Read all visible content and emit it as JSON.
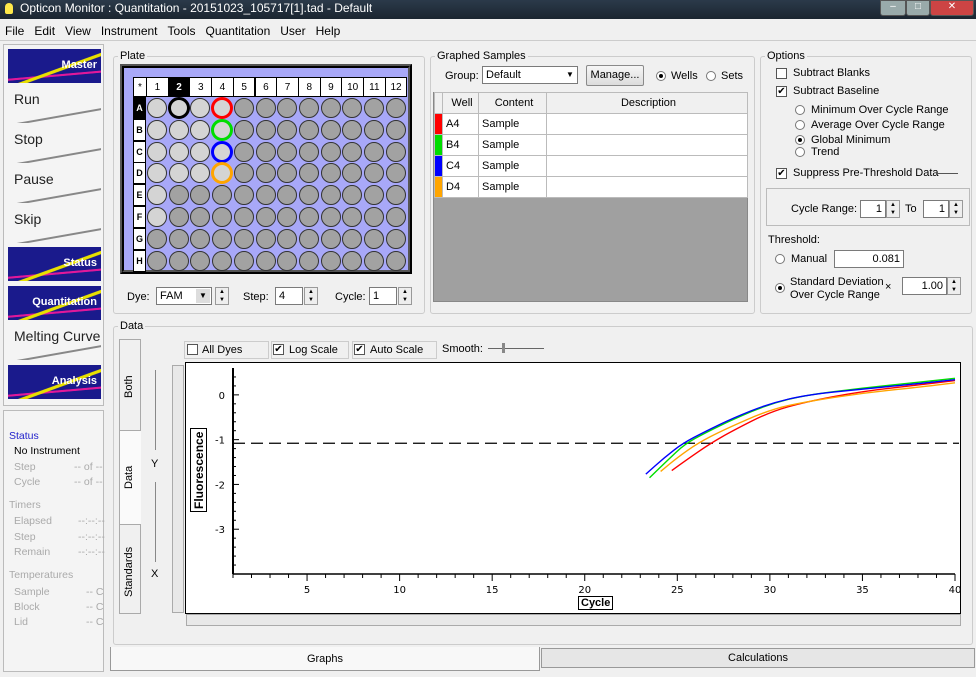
{
  "window": {
    "title": "Opticon Monitor : Quantitation - 20151023_105717[1].tad - Default"
  },
  "menu": [
    "File",
    "Edit",
    "View",
    "Instrument",
    "Tools",
    "Quantitation",
    "User",
    "Help"
  ],
  "toolbar": [
    {
      "label": "Master",
      "style": "dark",
      "icon": "master-icon"
    },
    {
      "label": "Run",
      "style": "light",
      "icon": "run-icon"
    },
    {
      "label": "Stop",
      "style": "light",
      "icon": "stop-icon"
    },
    {
      "label": "Pause",
      "style": "light",
      "icon": "pause-icon"
    },
    {
      "label": "Skip",
      "style": "light",
      "icon": "skip-icon"
    },
    {
      "label": "Status",
      "style": "dark",
      "icon": "status-icon"
    },
    {
      "label": "Quantitation",
      "style": "dark",
      "icon": "quantitation-icon"
    },
    {
      "label": "Melting Curve",
      "style": "light",
      "icon": "melting-curve-icon"
    },
    {
      "label": "Analysis",
      "style": "dark",
      "icon": "analysis-icon"
    }
  ],
  "status": {
    "header": "Status",
    "instrument": "No Instrument",
    "step_label": "Step",
    "step_value": "-- of --",
    "cycle_label": "Cycle",
    "cycle_value": "-- of --",
    "timers": "Timers",
    "elapsed": "Elapsed",
    "elapsed_value": "--:--:--",
    "tstep": "Step",
    "tstep_value": "--:--:--",
    "remain": "Remain",
    "remain_value": "--:--:--",
    "temps": "Temperatures",
    "sample": "Sample",
    "sample_value": "-- C",
    "block": "Block",
    "block_value": "-- C",
    "lid": "Lid",
    "lid_value": "-- C"
  },
  "plate": {
    "title": "Plate",
    "corner": "*",
    "columns": [
      "1",
      "2",
      "3",
      "4",
      "5",
      "6",
      "7",
      "8",
      "9",
      "10",
      "11",
      "12"
    ],
    "rows": [
      "A",
      "B",
      "C",
      "D",
      "E",
      "F",
      "G",
      "H"
    ],
    "selected_column": "2",
    "selected_row": "A",
    "highlighted_wells": [
      {
        "well": "A2",
        "color": "#000000"
      },
      {
        "well": "A4",
        "color": "#ff0000"
      },
      {
        "well": "B4",
        "color": "#00dd00"
      },
      {
        "well": "C4",
        "color": "#0000ff"
      },
      {
        "well": "D4",
        "color": "#ffa500"
      }
    ],
    "dye_label": "Dye:",
    "dye": "FAM",
    "step_label": "Step:",
    "step": "4",
    "cycle_label": "Cycle:",
    "cycle": "1"
  },
  "graphed": {
    "title": "Graphed Samples",
    "group_label": "Group:",
    "group": "Default",
    "manage": "Manage...",
    "wells_label": "Wells",
    "sets_label": "Sets",
    "mode": "Wells",
    "columns": [
      "Well",
      "Content",
      "Description"
    ],
    "rows": [
      {
        "well": "A4",
        "content": "Sample",
        "description": "",
        "color": "#ff0000"
      },
      {
        "well": "B4",
        "content": "Sample",
        "description": "",
        "color": "#00dd00"
      },
      {
        "well": "C4",
        "content": "Sample",
        "description": "",
        "color": "#0000ff"
      },
      {
        "well": "D4",
        "content": "Sample",
        "description": "",
        "color": "#ffa500"
      }
    ]
  },
  "options": {
    "title": "Options",
    "subtract_blanks": "Subtract Blanks",
    "subtract_blanks_checked": false,
    "subtract_baseline": "Subtract Baseline",
    "subtract_baseline_checked": true,
    "baseline_modes": [
      "Minimum Over Cycle Range",
      "Average Over Cycle Range",
      "Global Minimum",
      "Trend"
    ],
    "baseline_selected": "Global Minimum",
    "suppress": "Suppress Pre-Threshold Data",
    "suppress_checked": true,
    "cycle_range_label": "Cycle Range:",
    "cycle_from": "1",
    "to_label": "To",
    "cycle_to": "1",
    "threshold_label": "Threshold:",
    "manual_label": "Manual",
    "manual_value": "0.081",
    "stddev_label1": "Standard Deviation",
    "stddev_label2": "Over Cycle Range",
    "times": "×",
    "stddev_value": "1.00",
    "threshold_mode": "Standard Deviation"
  },
  "data": {
    "title": "Data",
    "side_tabs": [
      "Both",
      "Data",
      "Standards"
    ],
    "active_side_tab": "Data",
    "all_dyes": "All Dyes",
    "all_dyes_checked": false,
    "log_scale": "Log Scale",
    "log_scale_checked": true,
    "auto_scale": "Auto Scale",
    "auto_scale_checked": true,
    "smooth_label": "Smooth:",
    "y_slider": "Y",
    "x_slider": "X"
  },
  "chart_data": {
    "type": "line",
    "xlabel": "Cycle",
    "ylabel": "Fluorescence",
    "xlim": [
      1,
      40
    ],
    "ylim": [
      -4,
      0.6
    ],
    "xticks": [
      5,
      10,
      15,
      20,
      25,
      30,
      35,
      40
    ],
    "yticks": [
      0,
      -1,
      -2,
      -3
    ],
    "threshold": -1.08,
    "grid": false,
    "series": [
      {
        "well": "A4",
        "color": "#ff0000",
        "x": [
          24.7,
          25.5,
          26.8,
          28,
          30,
          32,
          35,
          38,
          40
        ],
        "y": [
          -1.69,
          -1.45,
          -1.08,
          -0.8,
          -0.38,
          -0.15,
          0.08,
          0.22,
          0.32
        ]
      },
      {
        "well": "B4",
        "color": "#00dd00",
        "x": [
          23.5,
          24.5,
          25.4,
          26.5,
          28,
          30,
          32,
          35,
          38,
          40
        ],
        "y": [
          -1.85,
          -1.45,
          -1.1,
          -0.85,
          -0.55,
          -0.2,
          0,
          0.15,
          0.28,
          0.37
        ]
      },
      {
        "well": "C4",
        "color": "#0000ff",
        "x": [
          23.3,
          24.3,
          25.3,
          26.5,
          28,
          30,
          32,
          35,
          38,
          40
        ],
        "y": [
          -1.77,
          -1.4,
          -1.08,
          -0.82,
          -0.52,
          -0.19,
          0,
          0.13,
          0.25,
          0.34
        ]
      },
      {
        "well": "D4",
        "color": "#ffa500",
        "x": [
          24.1,
          25,
          26.1,
          27.5,
          30,
          32,
          35,
          38,
          40
        ],
        "y": [
          -1.71,
          -1.4,
          -1.08,
          -0.78,
          -0.33,
          -0.15,
          0.04,
          0.17,
          0.27
        ]
      }
    ]
  },
  "bottom_tabs": [
    "Graphs",
    "Calculations"
  ],
  "active_bottom_tab": "Graphs"
}
